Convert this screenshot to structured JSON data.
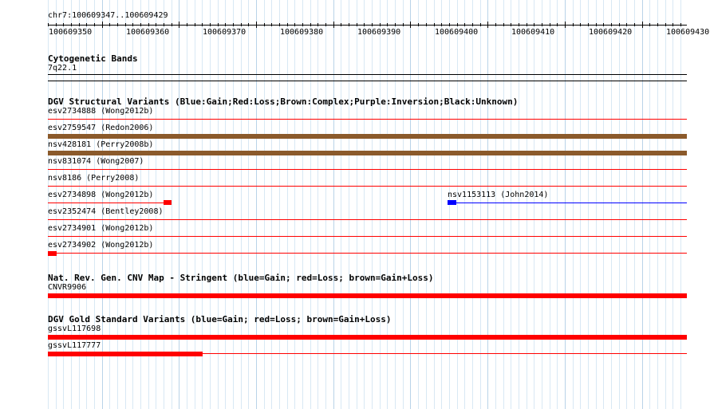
{
  "ruler": {
    "position_label": "chr7:100609347..100609429",
    "ticks": [
      "100609350",
      "100609360",
      "100609370",
      "100609380",
      "100609390",
      "100609400",
      "100609410",
      "100609420",
      "100609430"
    ]
  },
  "tracks": {
    "cytogenetic_bands": {
      "title": "Cytogenetic Bands",
      "band_label": "7q22.1"
    },
    "dgv_structural": {
      "title": "DGV Structural Variants (Blue:Gain;Red:Loss;Brown:Complex;Purple:Inversion;Black:Unknown)",
      "rows": [
        {
          "label": "esv2734888 (Wong2012b)"
        },
        {
          "label": "esv2759547 (Redon2006)",
          "color": "#8b5a2b"
        },
        {
          "label": "nsv428181 (Perry2008b)",
          "color": "#8b5a2b"
        },
        {
          "label": "nsv831074 (Wong2007)"
        },
        {
          "label": "nsv8186 (Perry2008)"
        },
        {
          "label": "esv2734898 (Wong2012b)",
          "color": "#ff0000",
          "second_label": "nsv1153113 (John2014)",
          "second_color": "#0000ff"
        },
        {
          "label": "esv2352474 (Bentley2008)"
        },
        {
          "label": "esv2734901 (Wong2012b)"
        },
        {
          "label": "esv2734902 (Wong2012b)",
          "color": "#ff0000"
        }
      ]
    },
    "cnv_map": {
      "title": "Nat. Rev. Gen. CNV Map - Stringent (blue=Gain; red=Loss; brown=Gain+Loss)",
      "rows": [
        {
          "label": "CNVR9906",
          "color": "#ff0000"
        }
      ]
    },
    "gold_standard": {
      "title": "DGV Gold Standard Variants (blue=Gain; red=Loss; brown=Gain+Loss)",
      "rows": [
        {
          "label": "gssvL117698",
          "color": "#ff0000"
        },
        {
          "label": "gssvL117777",
          "color": "#ff0000"
        }
      ]
    }
  },
  "colors": {
    "loss": "#ff0000",
    "gain": "#0000ff",
    "complex": "#8b5a2b",
    "row_line": "#ff0000",
    "grid": "#d8e8f4"
  }
}
